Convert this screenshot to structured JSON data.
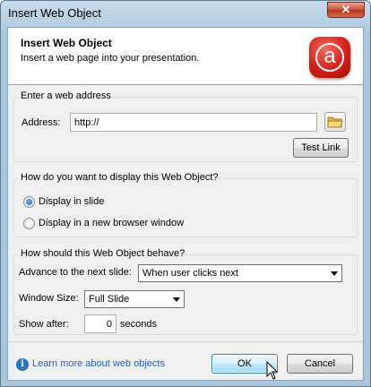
{
  "window": {
    "title": "Insert Web Object",
    "close_glyph": "✕"
  },
  "header": {
    "title": "Insert Web Object",
    "subtitle": "Insert a web page into your presentation.",
    "logo_glyph": "a",
    "logo_color": "#d51f18"
  },
  "address_section": {
    "legend": "Enter a web address",
    "address_label": "Address:",
    "address_value": "http://",
    "browse_icon": "folder-icon",
    "test_link_label": "Test Link"
  },
  "display_section": {
    "legend": "How do you want to display this Web Object?",
    "options": [
      {
        "label": "Display in slide",
        "checked": true
      },
      {
        "label": "Display in a new browser window",
        "checked": false
      }
    ]
  },
  "behave_section": {
    "legend": "How should this Web Object behave?",
    "advance_label": "Advance to the next slide:",
    "advance_value": "When user clicks next",
    "window_size_label": "Window Size:",
    "window_size_value": "Full Slide",
    "show_after_label": "Show after:",
    "show_after_value": "0",
    "show_after_unit": "seconds"
  },
  "footer": {
    "info_glyph": "i",
    "learn_more_link": "Learn more about web objects",
    "ok_label": "OK",
    "cancel_label": "Cancel"
  }
}
